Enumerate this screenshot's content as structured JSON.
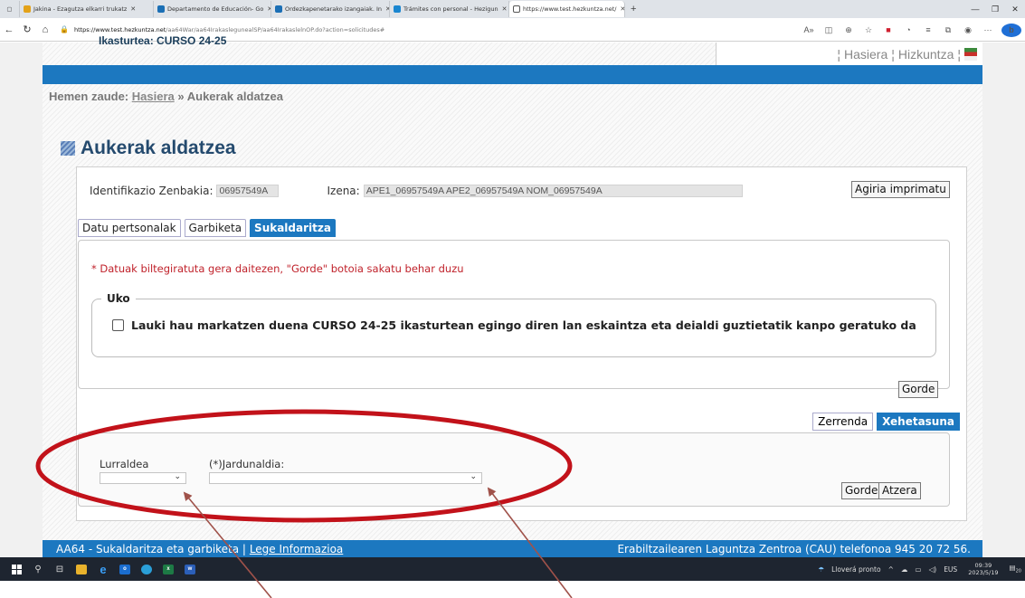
{
  "browser": {
    "tabs": [
      {
        "label": "Jakina - Ezagutza elkarri trukatz",
        "icon_color": "#e3a21a"
      },
      {
        "label": "Departamento de Educación- Go",
        "icon_color": "#1b6fb5"
      },
      {
        "label": "Ordezkapenetarako izangaiak. In",
        "icon_color": "#1b6fb5"
      },
      {
        "label": "Trámites con personal - Hezigun",
        "icon_color": "#1a86d0"
      },
      {
        "label": "https://www.test.hezkuntza.net/",
        "icon_color": "#ffffff"
      }
    ],
    "url_host": "https://www.test.hezkuntza.net",
    "url_path": "/aa64War/aa64IrakaslegunealSP/aa64IrakaslelnOP.do?action=solicitudes#"
  },
  "header": {
    "cut_title": "Ikasturtea: CURSO 24-25",
    "links": [
      "Hasiera",
      "Hizkuntza"
    ]
  },
  "breadcrumb": {
    "prefix": "Hemen zaude:",
    "home": "Hasiera",
    "sep": "»",
    "current": "Aukerak aldatzea"
  },
  "page_title": "Aukerak aldatzea",
  "id": {
    "id_label": "Identifikazio Zenbakia:",
    "id_value": "06957549A",
    "name_label": "Izena:",
    "name_value": "APE1_06957549A APE2_06957549A NOM_06957549A",
    "print_button": "Agiria imprimatu"
  },
  "tabs": [
    {
      "label": "Datu pertsonalak",
      "active": false
    },
    {
      "label": "Garbiketa",
      "active": false
    },
    {
      "label": "Sukaldaritza",
      "active": true
    }
  ],
  "form": {
    "required_note": "* Datuak biltegiratuta gera daitezen, \"Gorde\" botoia sakatu behar duzu",
    "legend": "Uko",
    "checkbox_label": "Lauki hau markatzen duena CURSO 24-25 ikasturtean egingo diren lan eskaintza eta deialdi guztietatik kanpo geratuko da",
    "save_button": "Gorde"
  },
  "view_tabs": [
    {
      "label": "Zerrenda",
      "active": false
    },
    {
      "label": "Xehetasuna",
      "active": true
    }
  ],
  "detail": {
    "territory_label": "Lurraldea",
    "territory_value": "",
    "workday_label": "(*)Jardunaldia:",
    "workday_value": "",
    "save_button": "Gorde",
    "back_button": "Atzera"
  },
  "footer": {
    "left": "AA64 - Sukaldaritza eta garbiketa |",
    "legal_link": "Lege Informazioa",
    "right": "Erabiltzailearen Laguntza Zentroa (CAU) telefonoa 945 20 72 56."
  },
  "taskbar": {
    "weather": "Lloverá pronto",
    "lang": "EUS",
    "time": "09:39",
    "date": "2023/5/19",
    "notif": "20"
  },
  "colors": {
    "brand_blue": "#1c78c0",
    "title_blue": "#244a6e",
    "required_red": "#c0222b",
    "annotation_red": "#c2121a",
    "arrow_brown": "#a0524a"
  }
}
